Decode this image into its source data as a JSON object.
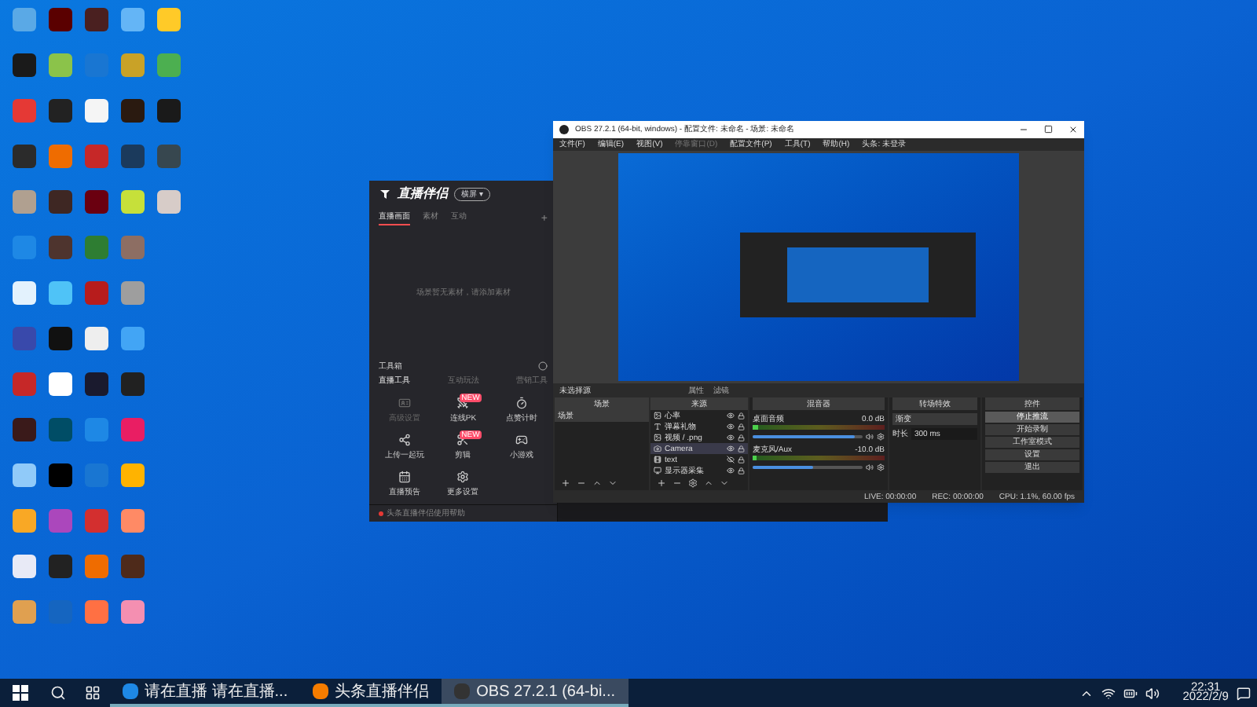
{
  "desktop_icons": [
    {
      "color": "#5aa9e6"
    },
    {
      "color": "#1a1a1a"
    },
    {
      "color": "#e53935"
    },
    {
      "color": "#2b2b2b"
    },
    {
      "color": "#b0a090"
    },
    {
      "color": "#1e88e5"
    },
    {
      "color": "#e3f2fd"
    },
    {
      "color": "#3949ab"
    },
    {
      "color": "#c62828"
    },
    {
      "color": "#3a1a1a"
    },
    {
      "color": "#90caf9"
    },
    {
      "color": "#f9a825"
    },
    {
      "color": "#e8eaf6"
    },
    {
      "color": "#e0a050"
    },
    {
      "color": "#5a0000"
    },
    {
      "color": "#8bc34a"
    },
    {
      "color": "#222222"
    },
    {
      "color": "#ef6c00"
    },
    {
      "color": "#3e2723"
    },
    {
      "color": "#4e342e"
    },
    {
      "color": "#4fc3f7"
    },
    {
      "color": "#111111"
    },
    {
      "color": "#ffffff"
    },
    {
      "color": "#004d66"
    },
    {
      "color": "#000000"
    },
    {
      "color": "#ab47bc"
    },
    {
      "color": "#222222"
    },
    {
      "color": "#1565c0"
    },
    {
      "color": "#4a2020"
    },
    {
      "color": "#1976d2"
    },
    {
      "color": "#f5f5f5"
    },
    {
      "color": "#c62828"
    },
    {
      "color": "#6a0010"
    },
    {
      "color": "#2e7d32"
    },
    {
      "color": "#b71c1c"
    },
    {
      "color": "#eeeeee"
    },
    {
      "color": "#1a1a2e"
    },
    {
      "color": "#1e88e5"
    },
    {
      "color": "#1976d2"
    },
    {
      "color": "#d32f2f"
    },
    {
      "color": "#ef6c00"
    },
    {
      "color": "#ff7043"
    },
    {
      "color": "#64b5f6"
    },
    {
      "color": "#c9a227"
    },
    {
      "color": "#2a1a10"
    },
    {
      "color": "#1b3a5c"
    },
    {
      "color": "#c6e03a"
    },
    {
      "color": "#8d6e63"
    },
    {
      "color": "#9e9e9e"
    },
    {
      "color": "#42a5f5"
    },
    {
      "color": "#212121"
    },
    {
      "color": "#e91e63"
    },
    {
      "color": "#ffb300"
    },
    {
      "color": "#ff8a65"
    },
    {
      "color": "#4e2a1a"
    },
    {
      "color": "#f48fb1"
    },
    {
      "color": "#ffca28"
    },
    {
      "color": "#4caf50"
    },
    {
      "color": "#1a1a1a"
    },
    {
      "color": "#37474f"
    },
    {
      "color": "#d7ccc8"
    }
  ],
  "left_app": {
    "brand": "直播伴侣",
    "mode_badge": "横屏 ▾",
    "scene_tabs": [
      {
        "label": "直播画面",
        "selected": true
      },
      {
        "label": "素材",
        "selected": false
      },
      {
        "label": "互动",
        "selected": false
      }
    ],
    "add_tab": "+",
    "empty_hint": "场景暂无素材，请添加素材",
    "toolbox_title": "工具箱",
    "tool_tabs": [
      {
        "label": "直播工具",
        "selected": true
      },
      {
        "label": "互动玩法",
        "selected": false
      },
      {
        "label": "营销工具",
        "selected": false
      }
    ],
    "tools": [
      {
        "kind": "card",
        "label": "高级设置",
        "disabled": true
      },
      {
        "kind": "pk",
        "label": "连线PK",
        "badge": "NEW",
        "disabled": false
      },
      {
        "kind": "timer",
        "label": "点赞计时",
        "disabled": false
      },
      {
        "kind": "share",
        "label": "上传一起玩",
        "disabled": false
      },
      {
        "kind": "cut",
        "label": "剪辑",
        "badge": "NEW",
        "disabled": false
      },
      {
        "kind": "game",
        "label": "小游戏",
        "disabled": false
      },
      {
        "kind": "calendar",
        "label": "直播预告",
        "disabled": false
      },
      {
        "kind": "gear",
        "label": "更多设置",
        "disabled": false
      }
    ],
    "footer": "头条直播伴侣使用帮助"
  },
  "obs": {
    "title": "OBS 27.2.1 (64-bit, windows) - 配置文件: 未命名 - 场景: 未命名",
    "menu": [
      {
        "label": "文件(F)",
        "disabled": false
      },
      {
        "label": "编辑(E)",
        "disabled": false
      },
      {
        "label": "视图(V)",
        "disabled": false
      },
      {
        "label": "停靠窗口(D)",
        "disabled": true
      },
      {
        "label": "配置文件(P)",
        "disabled": false
      },
      {
        "label": "工具(T)",
        "disabled": false
      },
      {
        "label": "帮助(H)",
        "disabled": false
      },
      {
        "label": "头条: 未登录",
        "disabled": false
      }
    ],
    "source_bar": {
      "status": "未选择源",
      "buttons": [
        "属性",
        "滤镜"
      ]
    },
    "scenes": {
      "title": "场景",
      "items": [
        {
          "label": "场景",
          "selected": true
        }
      ]
    },
    "sources": {
      "title": "来源",
      "items": [
        {
          "kind": "image",
          "label": "心率",
          "visible": true,
          "selected": false
        },
        {
          "kind": "text",
          "label": "弹幕礼物",
          "visible": true,
          "selected": false
        },
        {
          "kind": "image",
          "label": "视频 / .png",
          "visible": true,
          "selected": false
        },
        {
          "kind": "camera",
          "label": "Camera",
          "visible": true,
          "selected": true
        },
        {
          "kind": "media",
          "label": "text",
          "visible": false,
          "selected": false
        },
        {
          "kind": "display",
          "label": "显示器采集",
          "visible": true,
          "selected": false
        }
      ]
    },
    "mixer": {
      "title": "混音器",
      "channels": [
        {
          "name": "桌面音频",
          "reading": "0.0 dB",
          "level": 0.04,
          "volume": {
            "level": 0.93
          }
        },
        {
          "name": "麦克风/Aux",
          "reading": "-10.0 dB",
          "level": 0.03,
          "volume": {
            "level": 0.55
          }
        }
      ]
    },
    "transitions": {
      "title": "转场特效",
      "type": "渐变",
      "duration_label": "时长",
      "duration": "300 ms"
    },
    "controls": {
      "title": "控件",
      "buttons": [
        {
          "label": "停止推流",
          "active": true
        },
        {
          "label": "开始录制",
          "active": false
        },
        {
          "label": "工作室模式",
          "active": false
        },
        {
          "label": "设置",
          "active": false
        },
        {
          "label": "退出",
          "active": false
        }
      ]
    },
    "status": {
      "live": "LIVE: 00:00:00",
      "rec": "REC: 00:00:00",
      "cpu": "CPU: 1.1%, 60.00 fps"
    }
  },
  "taskbar": {
    "apps": [
      {
        "kind": "edge",
        "label": "请在直播 请在直播...",
        "selected": false
      },
      {
        "kind": "live",
        "label": "头条直播伴侣",
        "selected": false
      },
      {
        "kind": "obs",
        "label": "OBS 27.2.1 (64-bi...",
        "selected": true
      }
    ],
    "time": "22:31",
    "date": "2022/2/9"
  }
}
